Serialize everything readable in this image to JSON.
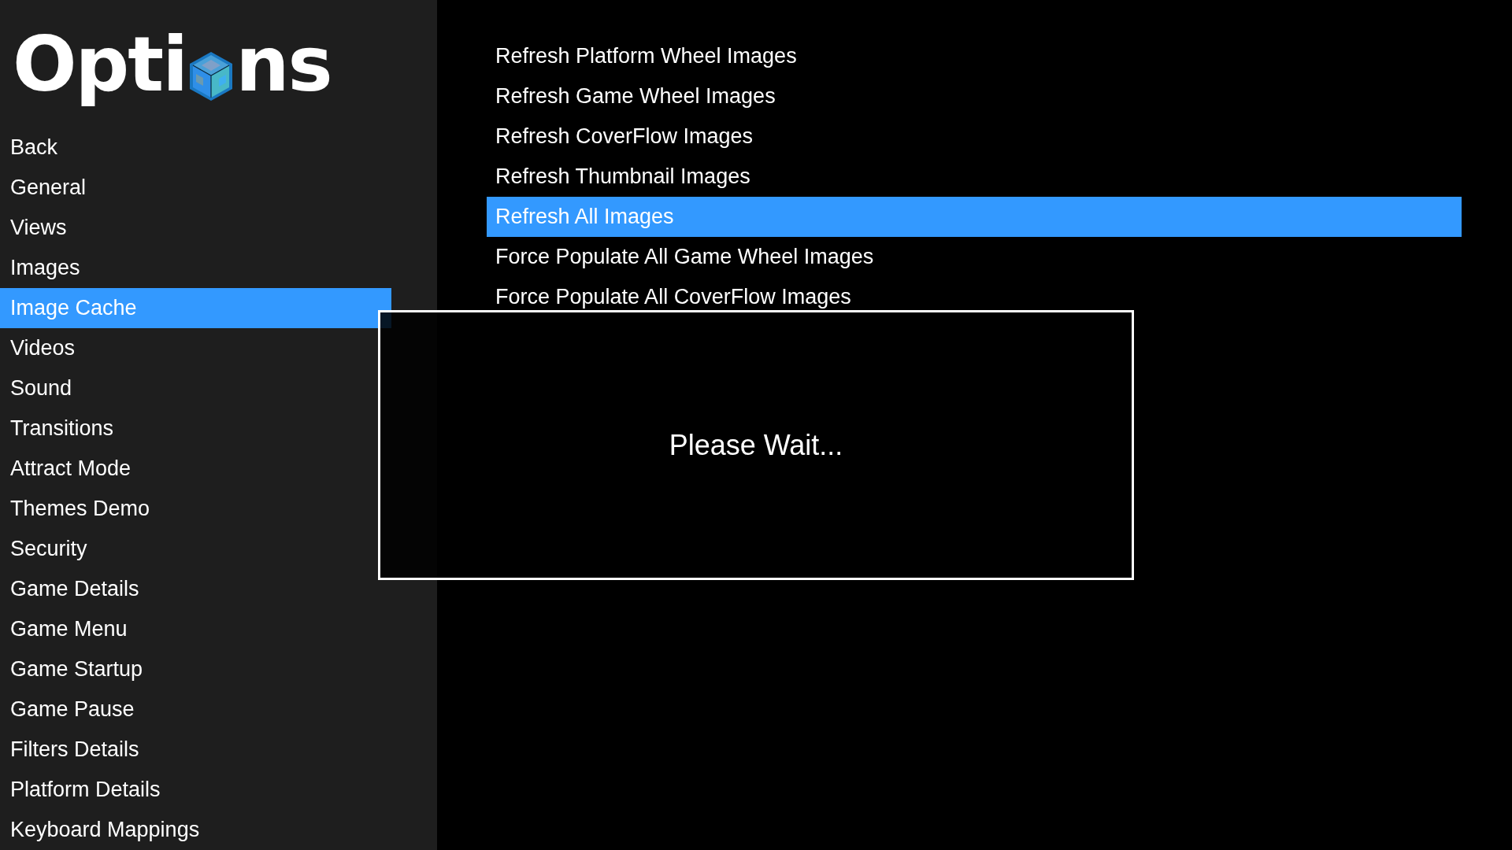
{
  "sidebar": {
    "title": {
      "before_icon": "Opti",
      "after_icon": "ns"
    },
    "items": [
      {
        "label": "Back",
        "selected": false
      },
      {
        "label": "General",
        "selected": false
      },
      {
        "label": "Views",
        "selected": false
      },
      {
        "label": "Images",
        "selected": false
      },
      {
        "label": "Image Cache",
        "selected": true
      },
      {
        "label": "Videos",
        "selected": false
      },
      {
        "label": "Sound",
        "selected": false
      },
      {
        "label": "Transitions",
        "selected": false
      },
      {
        "label": "Attract Mode",
        "selected": false
      },
      {
        "label": "Themes Demo",
        "selected": false
      },
      {
        "label": "Security",
        "selected": false
      },
      {
        "label": "Game Details",
        "selected": false
      },
      {
        "label": "Game Menu",
        "selected": false
      },
      {
        "label": "Game Startup",
        "selected": false
      },
      {
        "label": "Game Pause",
        "selected": false
      },
      {
        "label": "Filters Details",
        "selected": false
      },
      {
        "label": "Platform Details",
        "selected": false
      },
      {
        "label": "Keyboard Mappings",
        "selected": false
      }
    ]
  },
  "options": [
    {
      "label": "Refresh Platform Wheel Images",
      "selected": false
    },
    {
      "label": "Refresh Game Wheel Images",
      "selected": false
    },
    {
      "label": "Refresh CoverFlow Images",
      "selected": false
    },
    {
      "label": "Refresh Thumbnail Images",
      "selected": false
    },
    {
      "label": "Refresh All Images",
      "selected": true
    },
    {
      "label": "Force Populate All Game Wheel Images",
      "selected": false
    },
    {
      "label": "Force Populate All CoverFlow Images",
      "selected": false
    }
  ],
  "dialog": {
    "message": "Please Wait..."
  }
}
